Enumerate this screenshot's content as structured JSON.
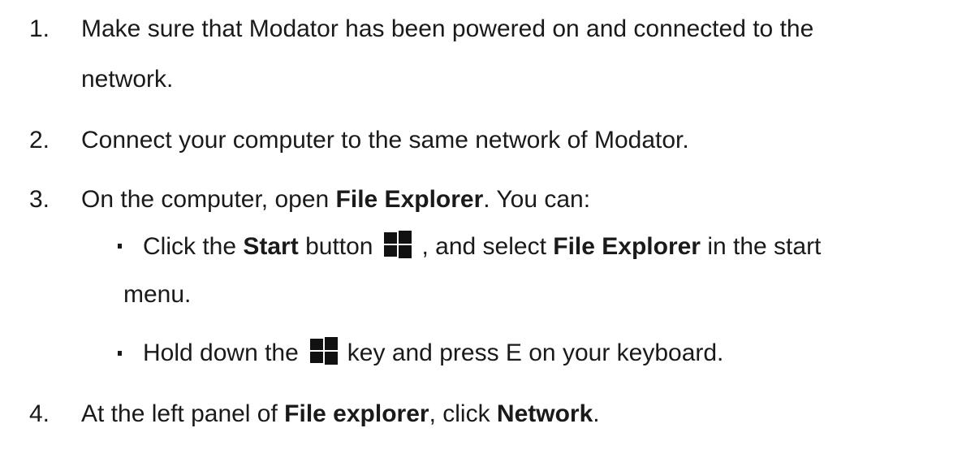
{
  "steps": [
    {
      "number": "1.",
      "line1": "Make sure that Modator has been powered on and connected to the",
      "line2": "network."
    },
    {
      "number": "2.",
      "text": "Connect your computer to the same network of Modator."
    },
    {
      "number": "3.",
      "text_before": "On the computer, open ",
      "bold": "File Explorer",
      "text_after": ". You can:",
      "bullets": [
        {
          "pre": "Click the ",
          "bold1": "Start",
          "mid": " button",
          "icon": "windows-logo-icon",
          "post": ", and select ",
          "bold2": "File Explorer",
          "end": " in the start",
          "line2": "menu."
        },
        {
          "pre": "Hold down the",
          "icon": "windows-logo-icon",
          "post": "key and press E on your keyboard."
        }
      ]
    },
    {
      "number": "4.",
      "text_before": "At the left panel of  ",
      "bold1": "File explorer",
      "mid": ", click ",
      "bold2": "Network",
      "end": "."
    }
  ],
  "colors": {
    "text": "#1a1a1a",
    "background": "#ffffff"
  }
}
